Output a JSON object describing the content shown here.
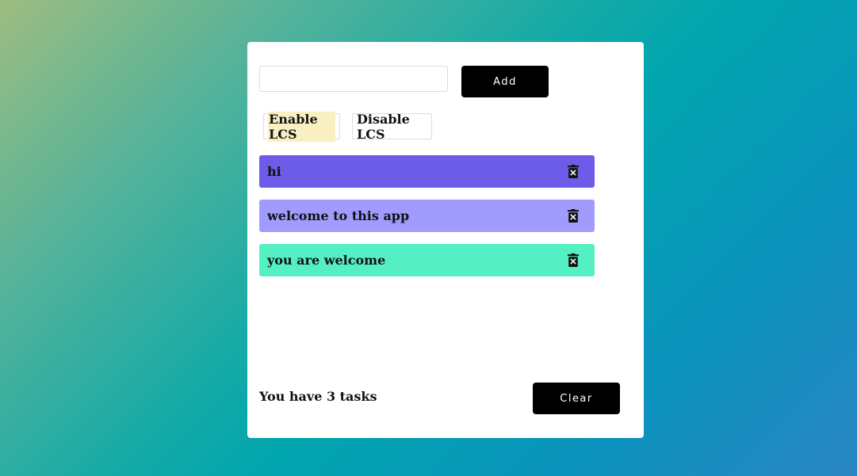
{
  "input": {
    "value": "",
    "placeholder": ""
  },
  "add_button": {
    "label": "Add"
  },
  "lcs": {
    "enable_label": "Enable LCS",
    "disable_label": "Disable LCS",
    "highlight_color": "#f8efc2"
  },
  "tasks": [
    {
      "text": "hi",
      "color": "#6c5ce7",
      "icon": "trash-icon"
    },
    {
      "text": "welcome to this app",
      "color": "#a29bfe",
      "icon": "trash-icon"
    },
    {
      "text": "you are welcome",
      "color": "#55efc4",
      "icon": "trash-icon"
    }
  ],
  "footer": {
    "count_text": "You have 3 tasks",
    "clear_label": "Clear"
  },
  "colors": {
    "button_bg": "#000000",
    "card_bg": "#ffffff"
  }
}
